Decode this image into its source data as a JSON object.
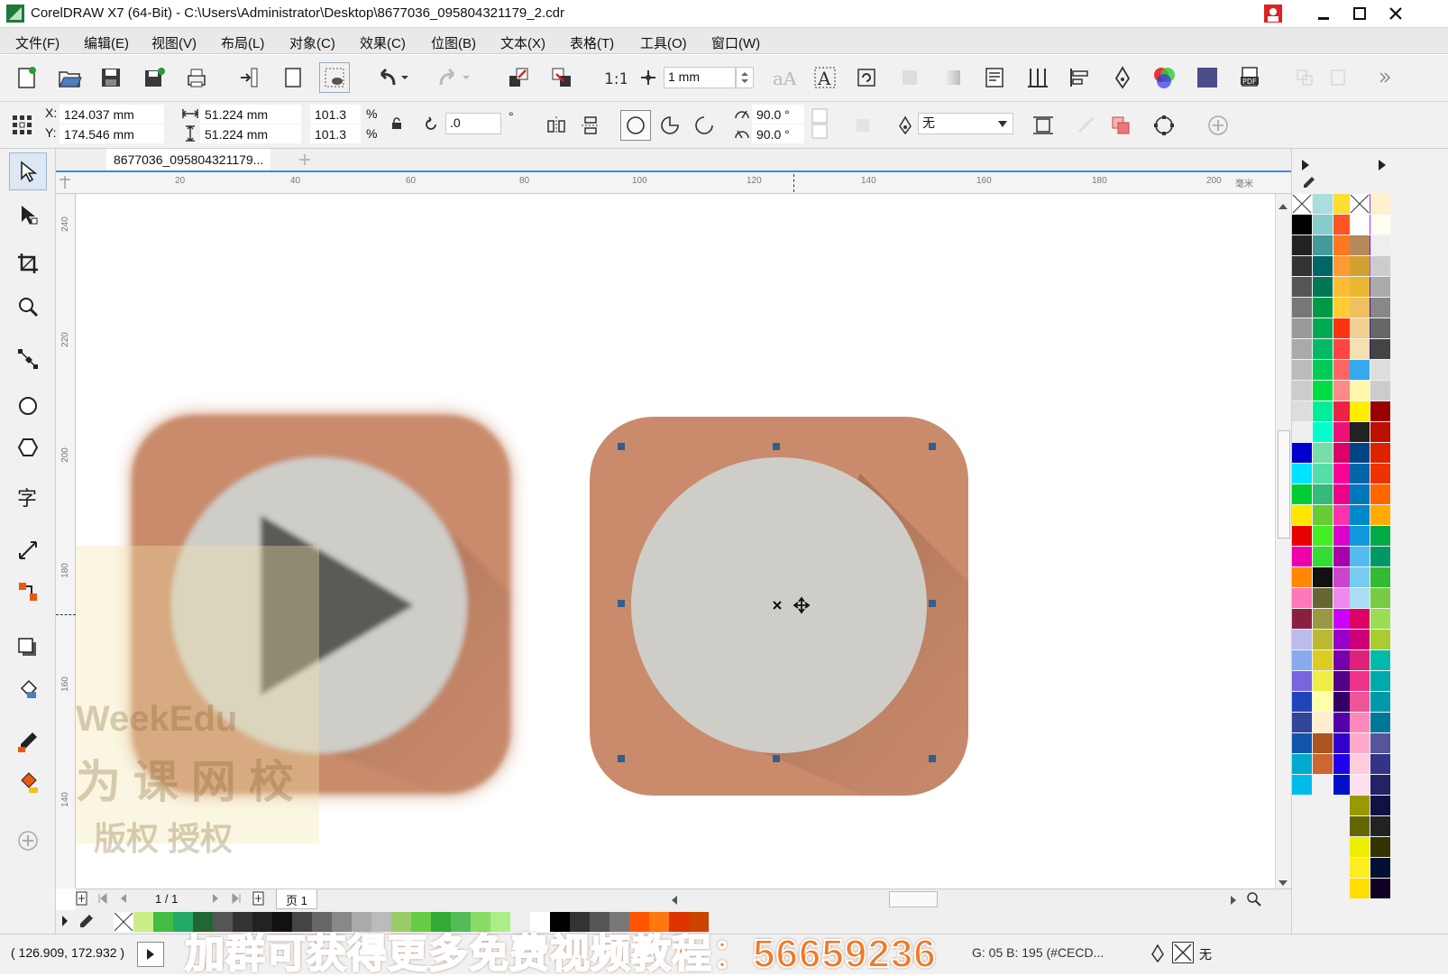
{
  "window": {
    "title": "CorelDRAW X7 (64-Bit) - C:\\Users\\Administrator\\Desktop\\8677036_095804321179_2.cdr",
    "minimize_icon": "minimize-icon",
    "maximize_icon": "maximize-icon",
    "close_icon": "close-icon"
  },
  "menu": [
    "文件(F)",
    "编辑(E)",
    "视图(V)",
    "布局(L)",
    "对象(C)",
    "效果(C)",
    "位图(B)",
    "文本(X)",
    "表格(T)",
    "工具(O)",
    "窗口(W)"
  ],
  "toolbar": {
    "nudge_value": "1 mm"
  },
  "propbar": {
    "x_label": "X:",
    "x_value": "124.037 mm",
    "y_label": "Y:",
    "y_value": "174.546 mm",
    "width_value": "51.224 mm",
    "height_value": "51.224 mm",
    "scale_x": "101.3",
    "scale_y": "101.3",
    "percent_x": "%",
    "percent_y": "%",
    "rotation": ".0",
    "degree": "°",
    "angle_start": "90.0 °",
    "angle_end": "90.0 °",
    "outline_value": "无"
  },
  "document": {
    "tab_label": "8677036_095804321179..."
  },
  "ruler": {
    "h_ticks": [
      "20",
      "40",
      "60",
      "80",
      "100",
      "120",
      "140",
      "160",
      "180",
      "200"
    ],
    "h_unit": "毫米",
    "v_ticks": [
      "240",
      "220",
      "200",
      "180",
      "160",
      "140"
    ]
  },
  "pagebar": {
    "page_count": "1 / 1",
    "page_tab": "页 1"
  },
  "status": {
    "cursor_coords": "( 126.909, 172.932 )",
    "color_info": "G: 05 B: 195 (#CECD...",
    "outline_none": "无"
  },
  "banner": {
    "text": "加群可获得更多免费视频教程：56659236"
  },
  "watermark": {
    "line1": "WeekEdu",
    "line2": "为 课 网 校",
    "line3": "版权    授权"
  },
  "colors": {
    "accent": "#3d8bd6",
    "icon_bg": "#c98b6c",
    "icon_circle": "#cecdc8",
    "triangle": "#555350",
    "banner": "#f07a28"
  }
}
